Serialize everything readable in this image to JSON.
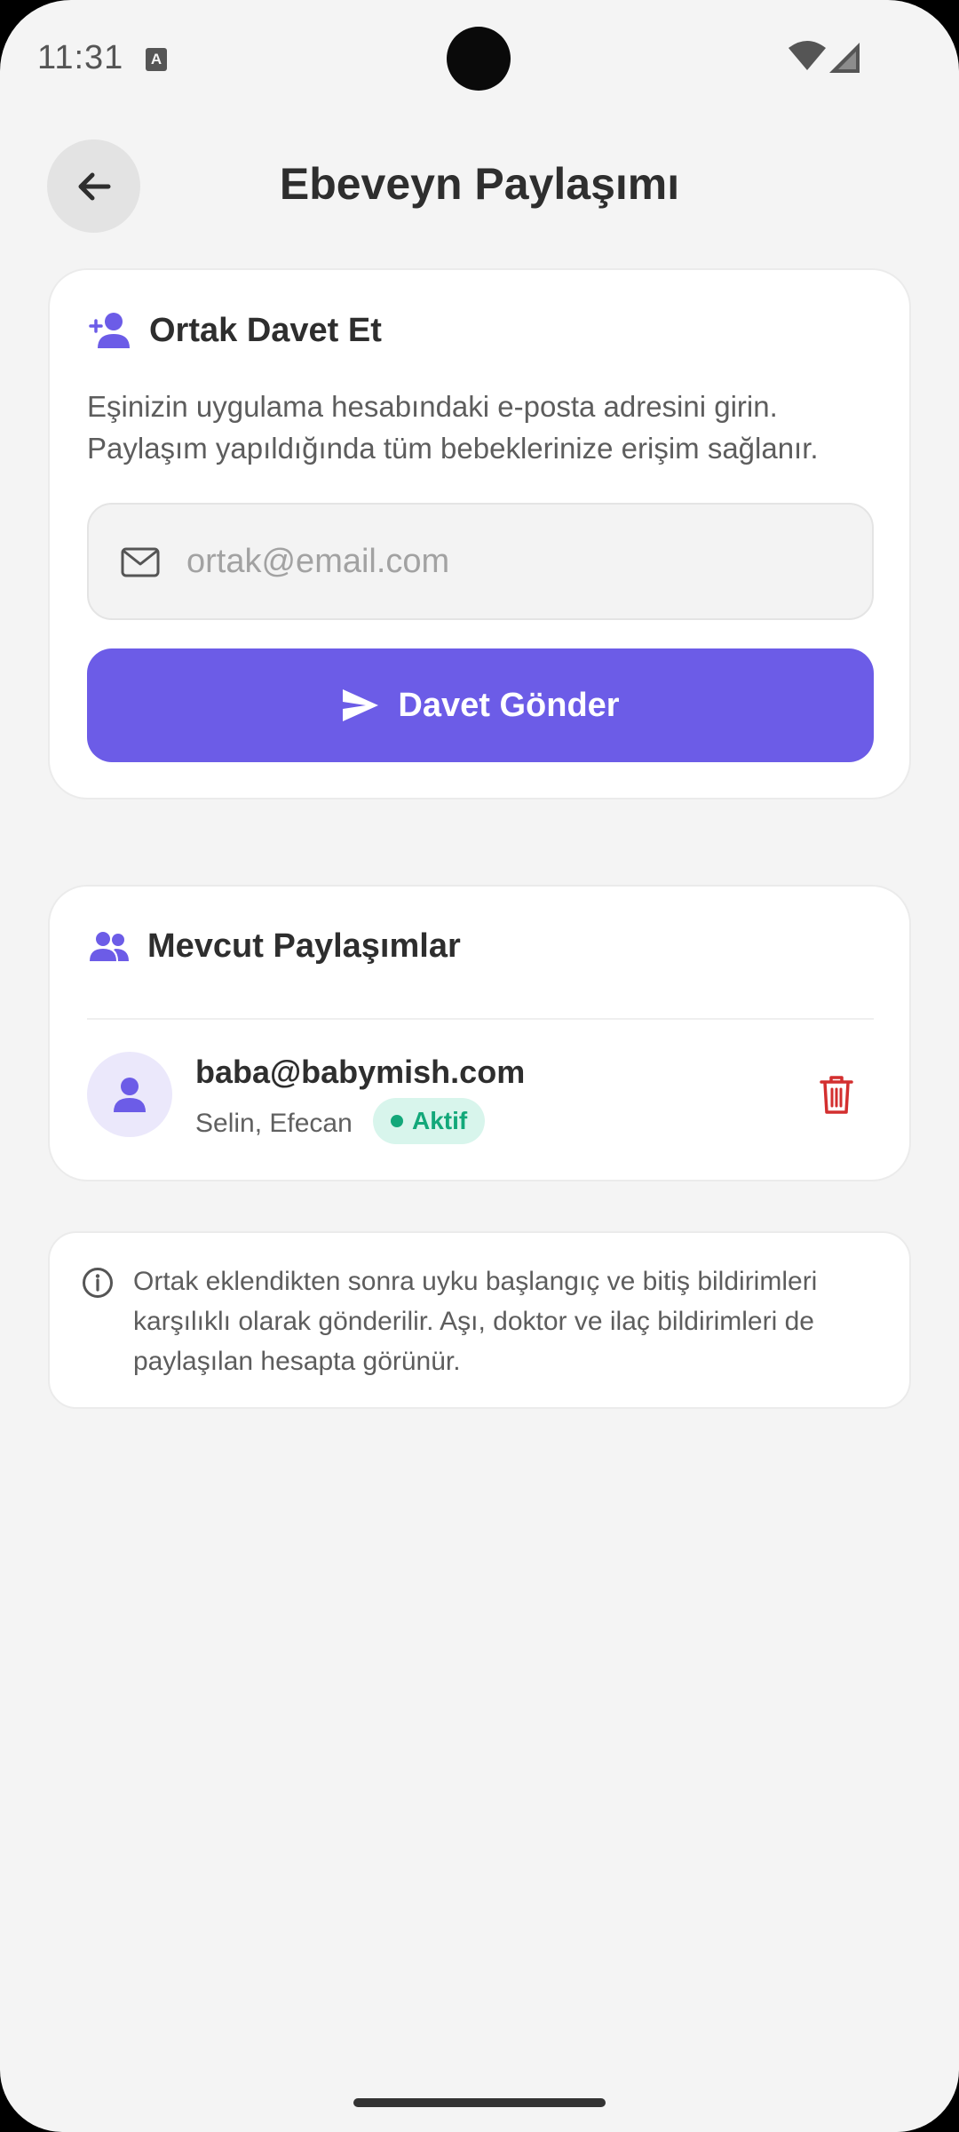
{
  "status_bar": {
    "time": "11:31",
    "notification_glyph": "A"
  },
  "header": {
    "title": "Ebeveyn Paylaşımı",
    "back_icon": "arrow-left-icon"
  },
  "invite_card": {
    "title": "Ortak Davet Et",
    "icon": "person-add-icon",
    "description": "Eşinizin uygulama hesabındaki e-posta adresini girin. Paylaşım yapıldığında tüm bebeklerinize erişim sağlanır.",
    "email_placeholder": "ortak@email.com",
    "email_value": "",
    "send_button_label": "Davet Gönder"
  },
  "shares_card": {
    "title": "Mevcut Paylaşımlar",
    "icon": "people-icon",
    "items": [
      {
        "email": "baba@babymish.com",
        "babies": "Selin, Efecan",
        "status": "Aktif",
        "status_color": "#13a87a"
      }
    ]
  },
  "info_note": {
    "text": "Ortak eklendikten sonra uyku başlangıç ve bitiş bildirimleri karşılıklı olarak gönderilir. Aşı, doktor ve ilaç bildirimleri de paylaşılan hesapta görünür."
  },
  "colors": {
    "accent": "#6c5ce7",
    "danger": "#d32f2f",
    "success": "#13a87a",
    "background": "#f4f4f4"
  }
}
